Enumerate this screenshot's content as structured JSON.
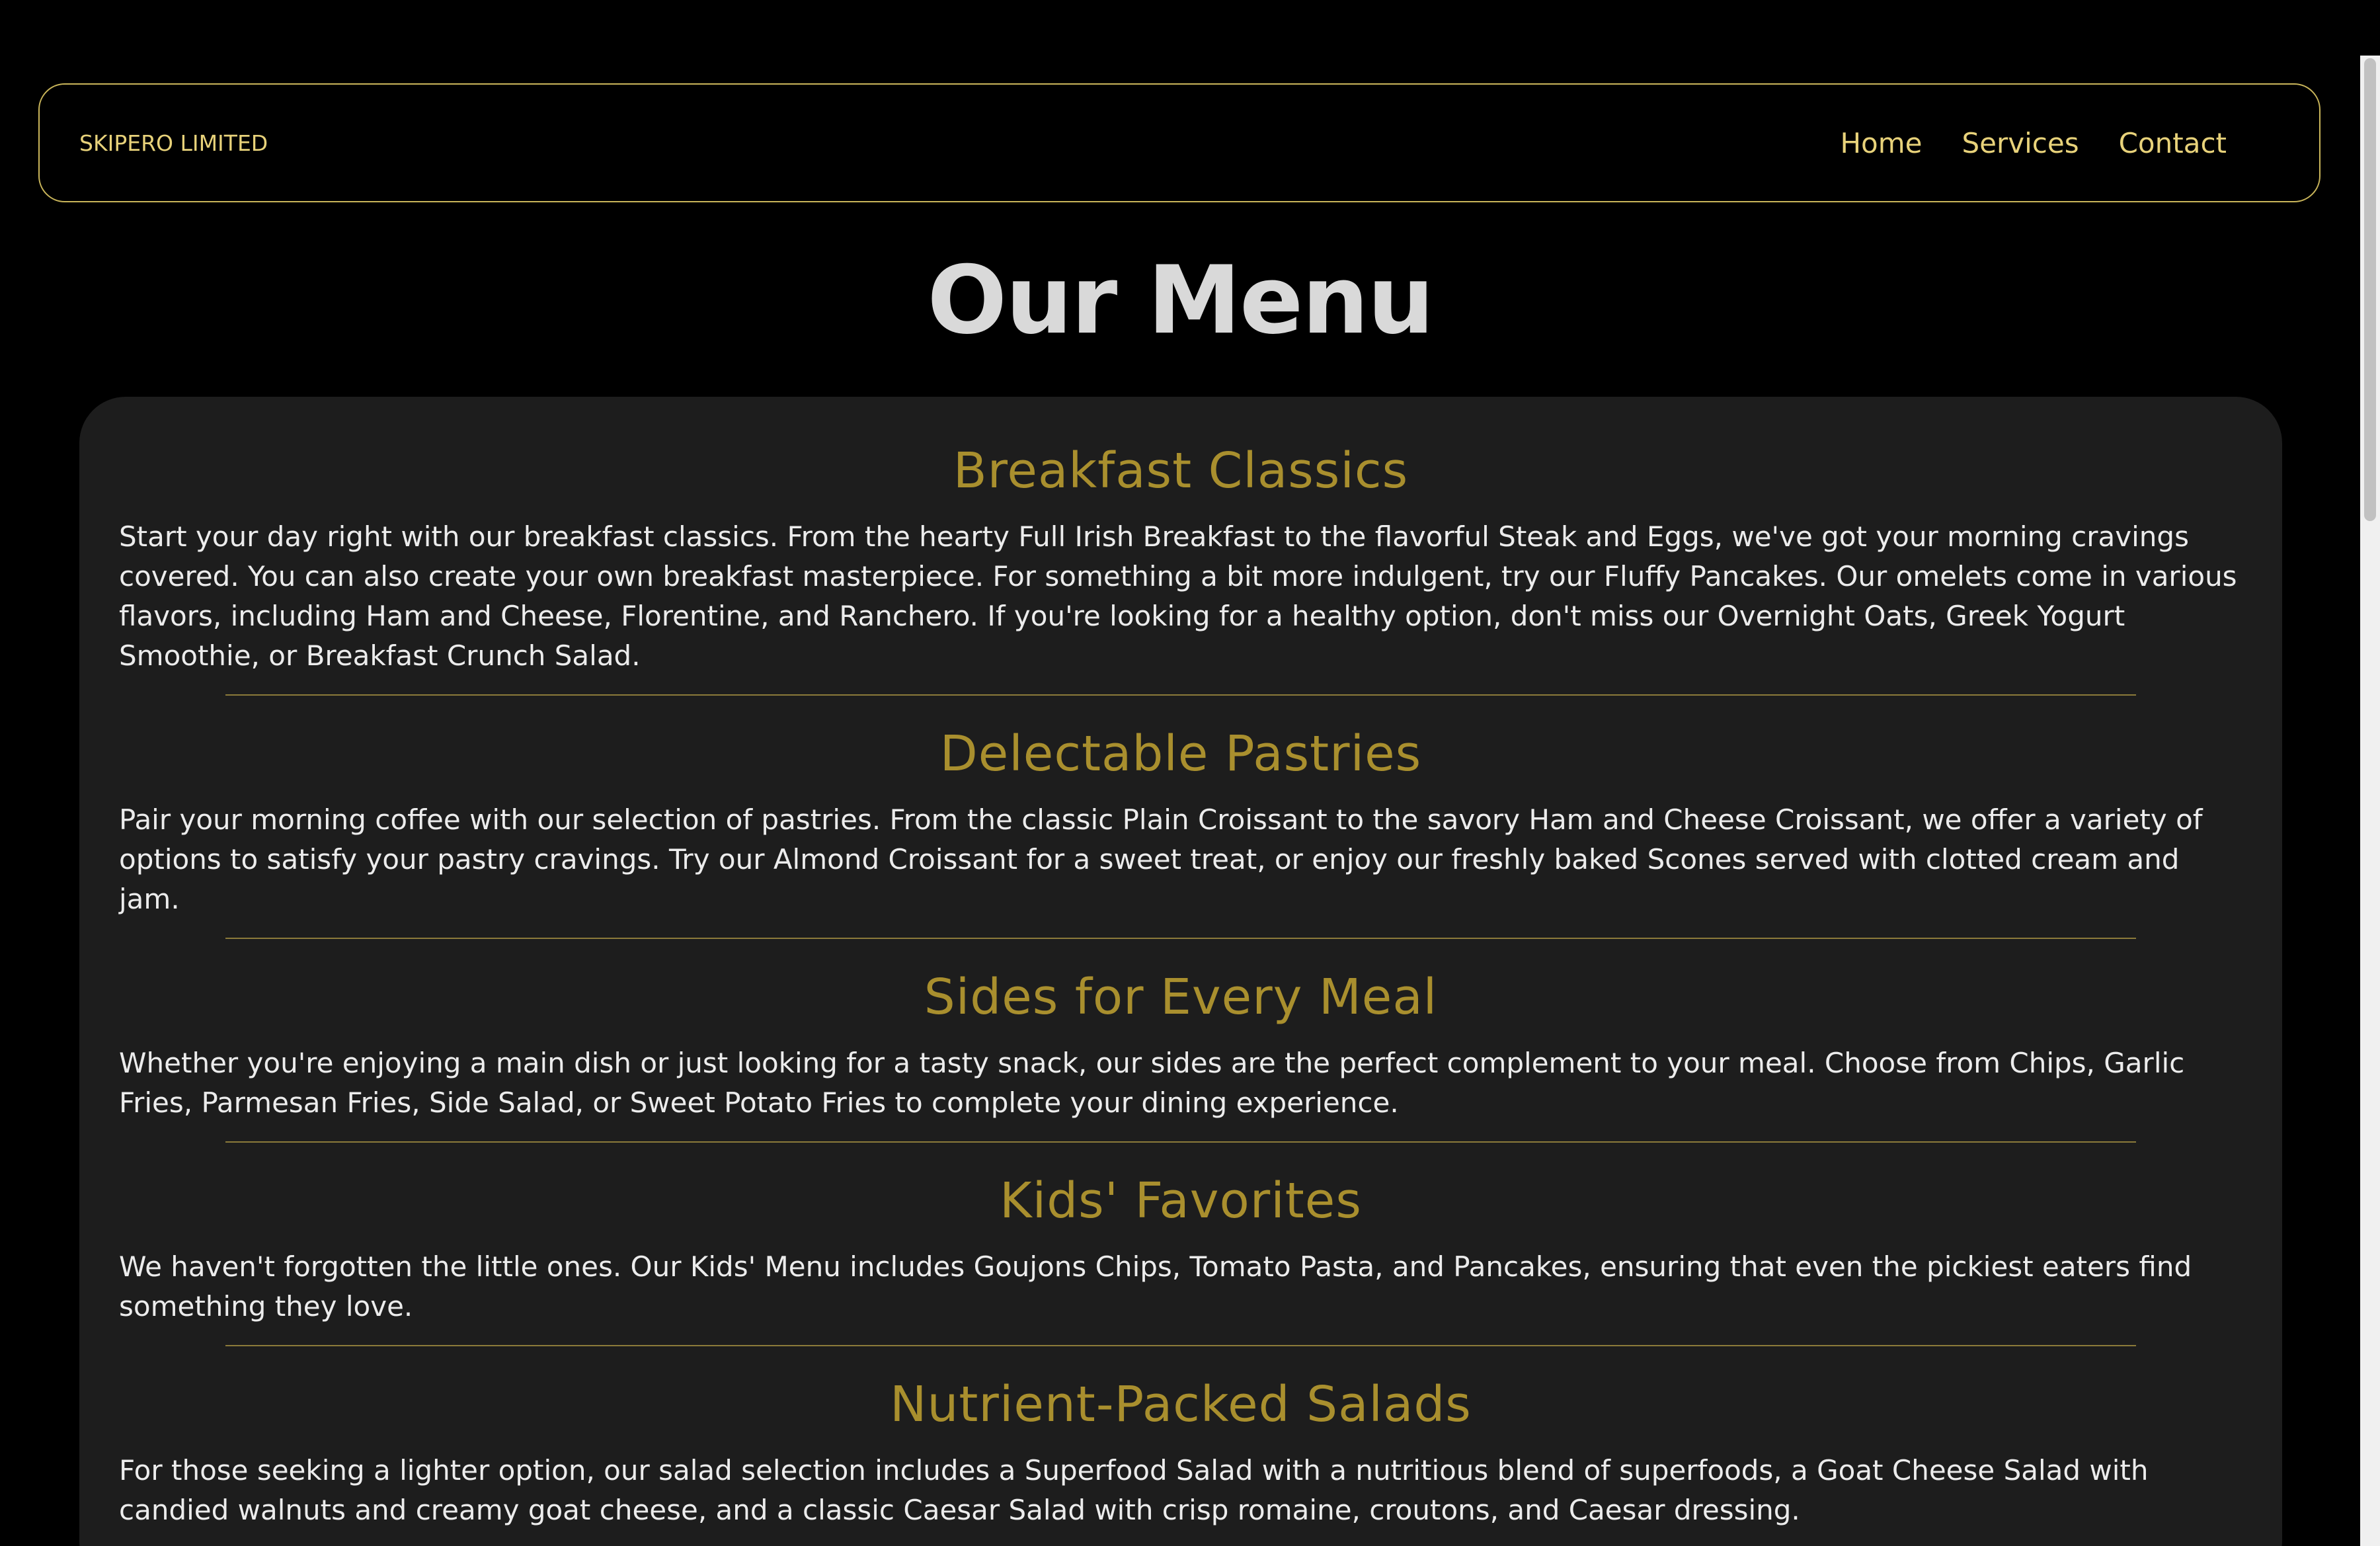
{
  "header": {
    "brand": "SKIPERO LIMITED",
    "nav": [
      {
        "label": "Home"
      },
      {
        "label": "Services"
      },
      {
        "label": "Contact"
      }
    ]
  },
  "page": {
    "title": "Our Menu"
  },
  "sections": [
    {
      "title": "Breakfast Classics",
      "text": "Start your day right with our breakfast classics. From the hearty Full Irish Breakfast to the flavorful Steak and Eggs, we've got your morning cravings covered. You can also create your own breakfast masterpiece. For something a bit more indulgent, try our Fluffy Pancakes. Our omelets come in various flavors, including Ham and Cheese, Florentine, and Ranchero. If you're looking for a healthy option, don't miss our Overnight Oats, Greek Yogurt Smoothie, or Breakfast Crunch Salad."
    },
    {
      "title": "Delectable Pastries",
      "text": "Pair your morning coffee with our selection of pastries. From the classic Plain Croissant to the savory Ham and Cheese Croissant, we offer a variety of options to satisfy your pastry cravings. Try our Almond Croissant for a sweet treat, or enjoy our freshly baked Scones served with clotted cream and jam."
    },
    {
      "title": "Sides for Every Meal",
      "text": "Whether you're enjoying a main dish or just looking for a tasty snack, our sides are the perfect complement to your meal. Choose from Chips, Garlic Fries, Parmesan Fries, Side Salad, or Sweet Potato Fries to complete your dining experience."
    },
    {
      "title": "Kids' Favorites",
      "text": "We haven't forgotten the little ones. Our Kids' Menu includes Goujons Chips, Tomato Pasta, and Pancakes, ensuring that even the pickiest eaters find something they love."
    },
    {
      "title": "Nutrient-Packed Salads",
      "text": "For those seeking a lighter option, our salad selection includes a Superfood Salad with a nutritious blend of superfoods, a Goat Cheese Salad with candied walnuts and creamy goat cheese, and a classic Caesar Salad with crisp romaine, croutons, and Caesar dressing."
    }
  ],
  "colors": {
    "background": "#000000",
    "card": "#1d1d1d",
    "accent": "#a98f2e",
    "nav_text": "#e8d27a",
    "body_text": "#ececec"
  }
}
